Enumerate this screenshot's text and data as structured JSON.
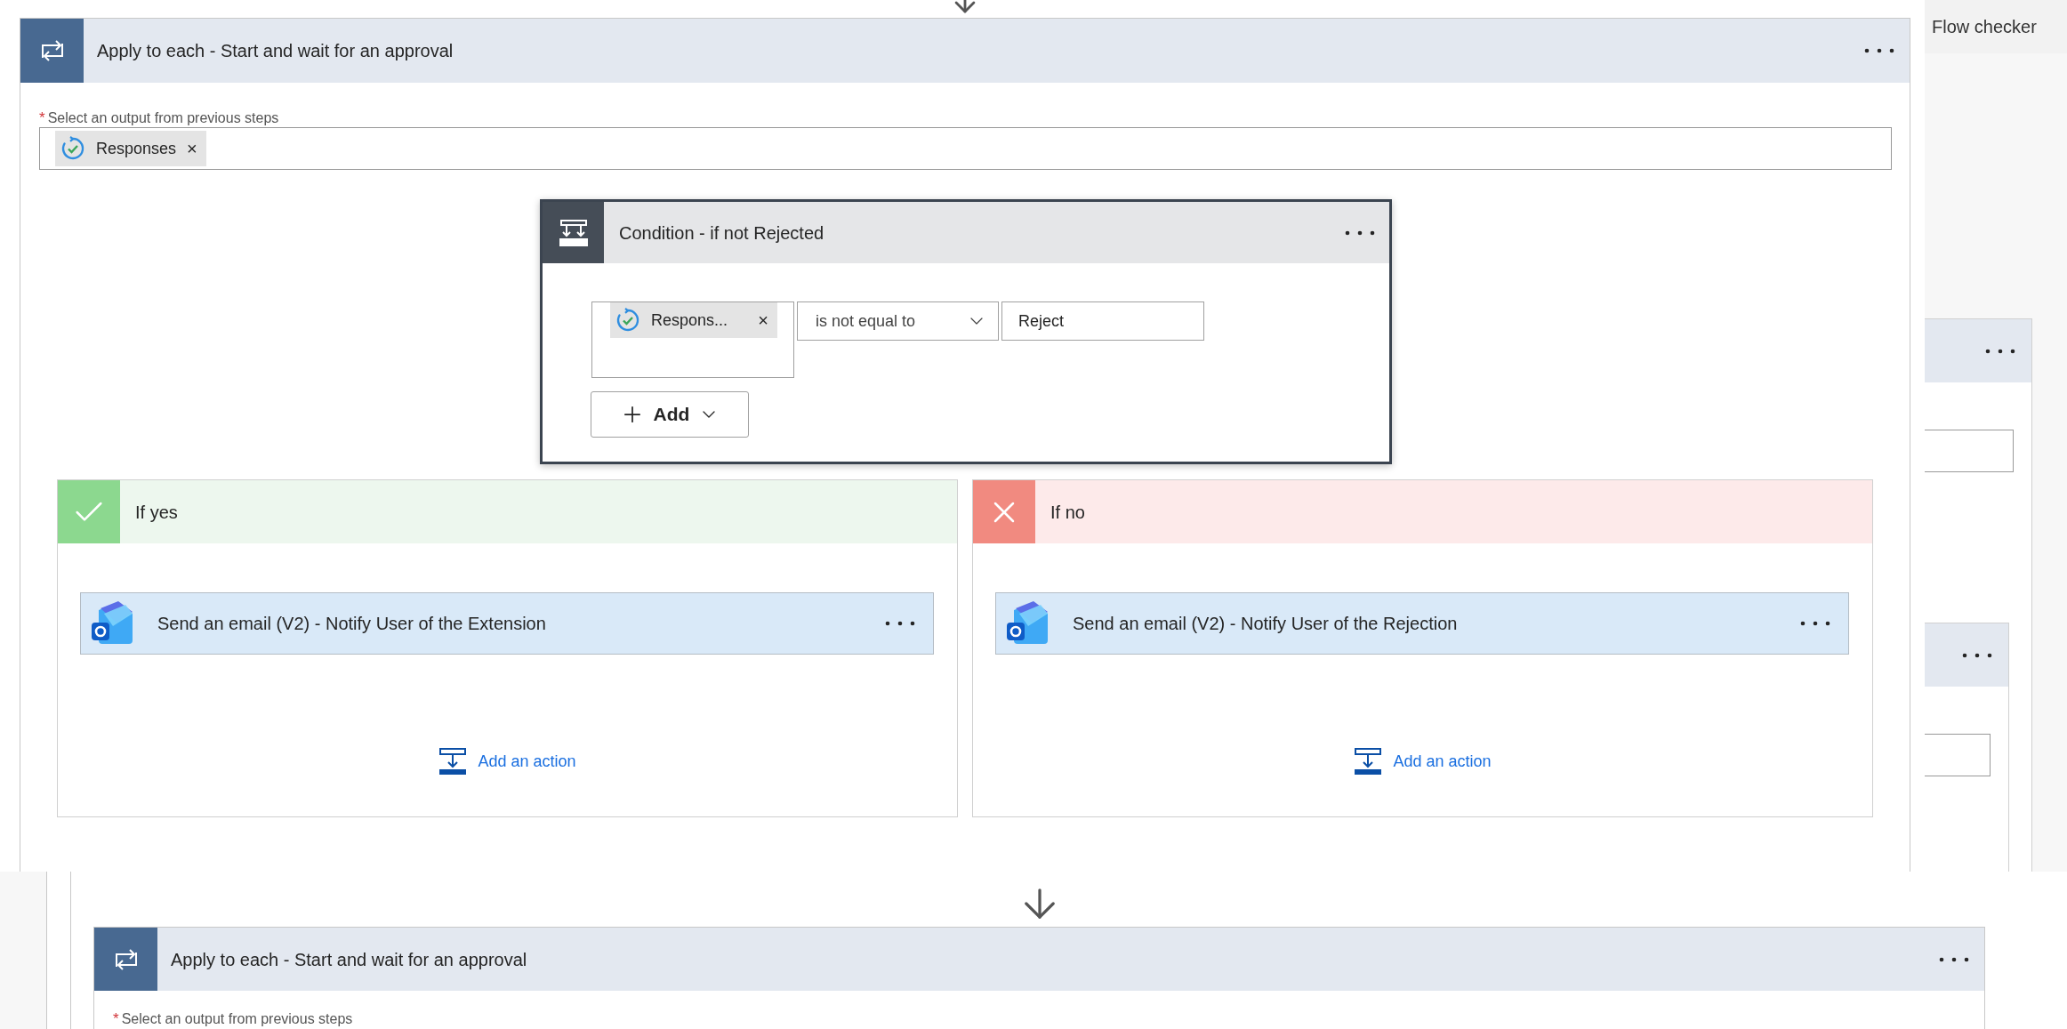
{
  "apply_to_each": {
    "title": "Apply to each - Start and wait for an approval",
    "required_mark": "*",
    "output_label": "Select an output from previous steps",
    "token": {
      "label": "Responses",
      "remove": "×"
    }
  },
  "condition": {
    "title": "Condition - if not Rejected",
    "left_token": {
      "label": "Respons...",
      "remove": "×"
    },
    "operator": "is not equal to",
    "value": "Reject",
    "add_button": "Add"
  },
  "branches": [
    {
      "kind": "yes",
      "title": "If yes",
      "action": {
        "title": "Send an email (V2) - Notify User of the Extension"
      },
      "add_action": "Add an action"
    },
    {
      "kind": "no",
      "title": "If no",
      "action": {
        "title": "Send an email (V2) - Notify User of the Rejection"
      },
      "add_action": "Add an action"
    }
  ],
  "side_panel": {
    "title": "Flow checker"
  },
  "next_step": {
    "title": "Apply to each - Start and wait for an approval",
    "required_mark": "*",
    "output_label": "Select an output from previous steps"
  }
}
